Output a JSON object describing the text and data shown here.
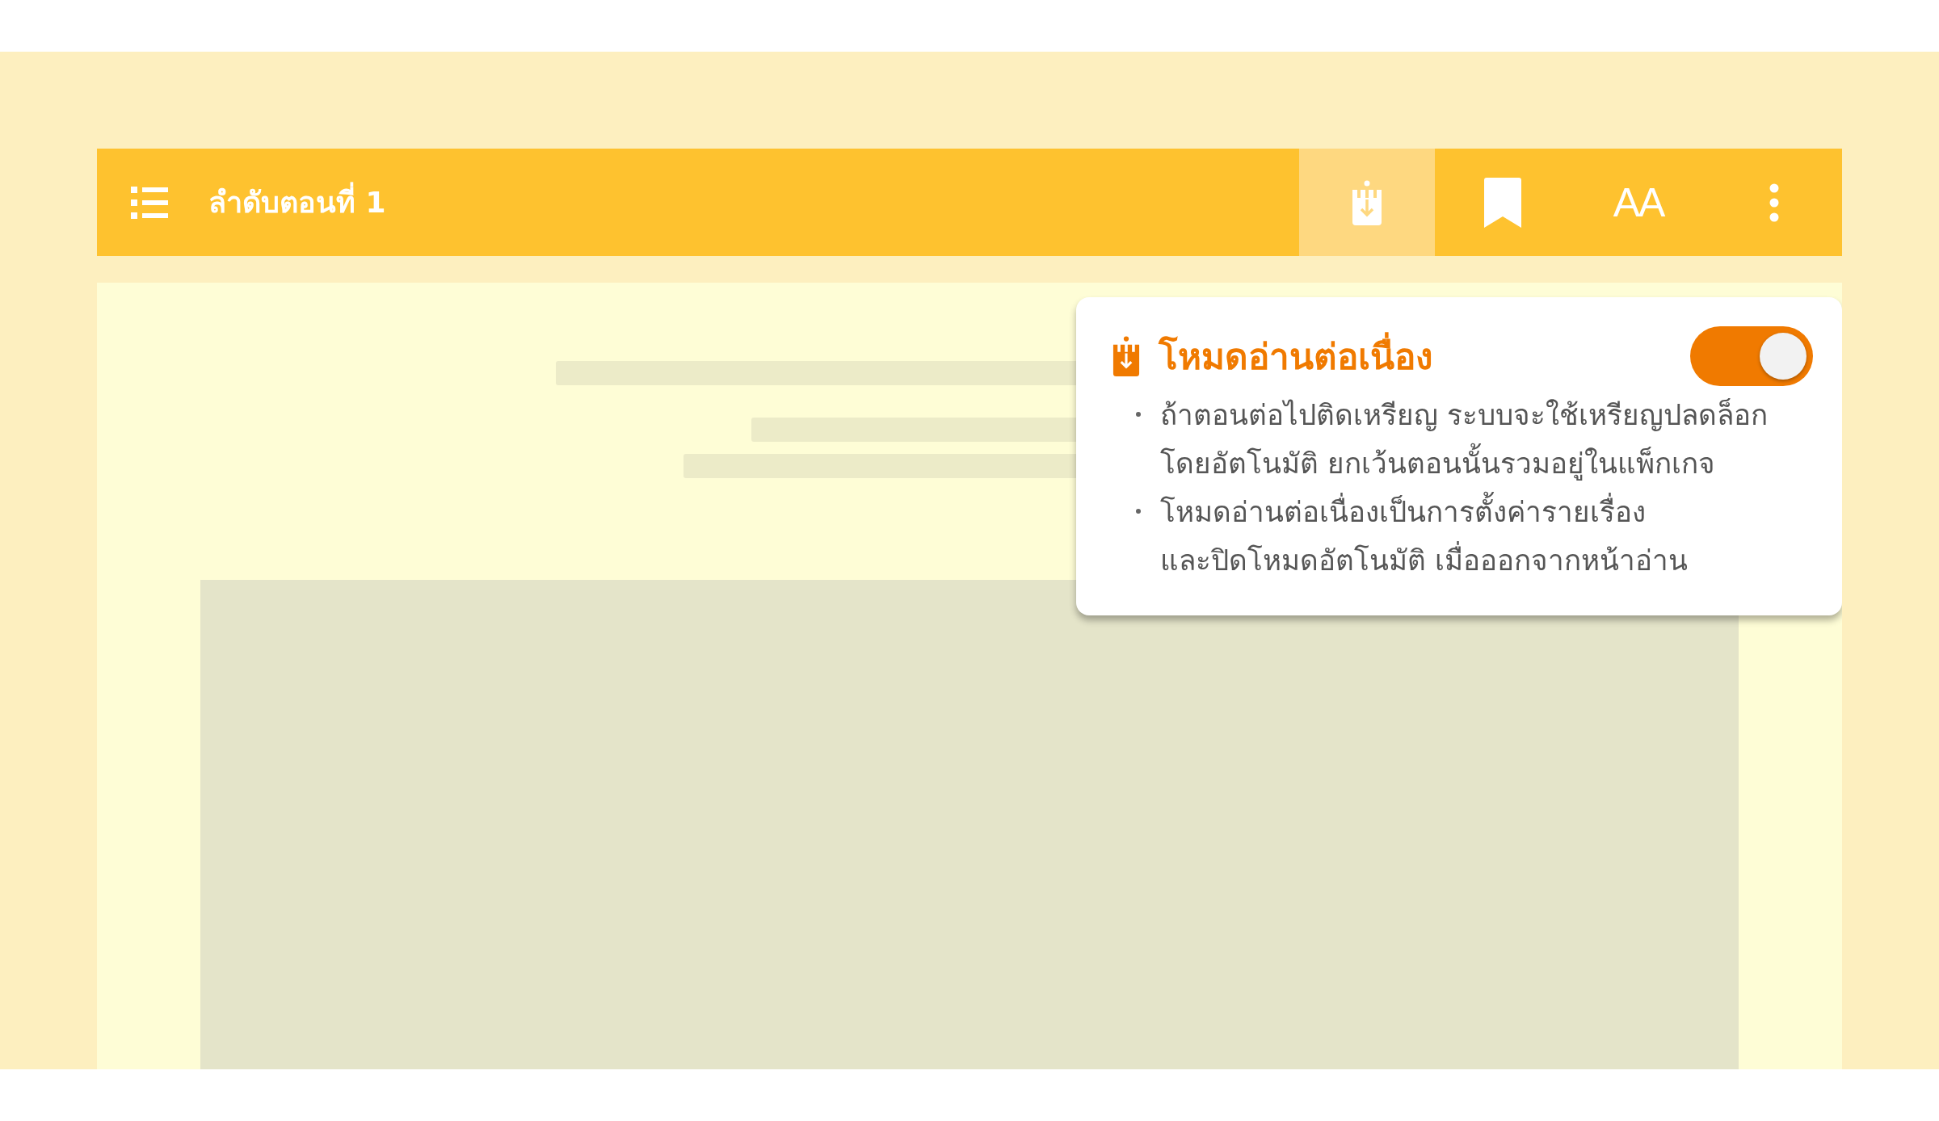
{
  "toolbar": {
    "title": "ลำดับตอนที่ 1",
    "buttons": [
      {
        "kind": "autoread",
        "selected": true
      },
      {
        "kind": "bookmark",
        "selected": false
      },
      {
        "kind": "fontsize",
        "selected": false,
        "label": "AA"
      },
      {
        "kind": "more",
        "selected": false
      }
    ]
  },
  "popup": {
    "title": "โหมดอ่านต่อเนื่อง",
    "toggle": {
      "on": true
    },
    "bullets": [
      "ถ้าตอนต่อไปติดเหรียญ ระบบจะใช้เหรียญปลดล็อก\nโดยอัตโนมัติ ยกเว้นตอนนั้นรวมอยู่ในแพ็กเกจ",
      "โหมดอ่านต่อเนื่องเป็นการตั้งค่ารายเรื่อง\nและปิดโหมดอัตโนมัติ เมื่อออกจากหน้าอ่าน"
    ]
  }
}
